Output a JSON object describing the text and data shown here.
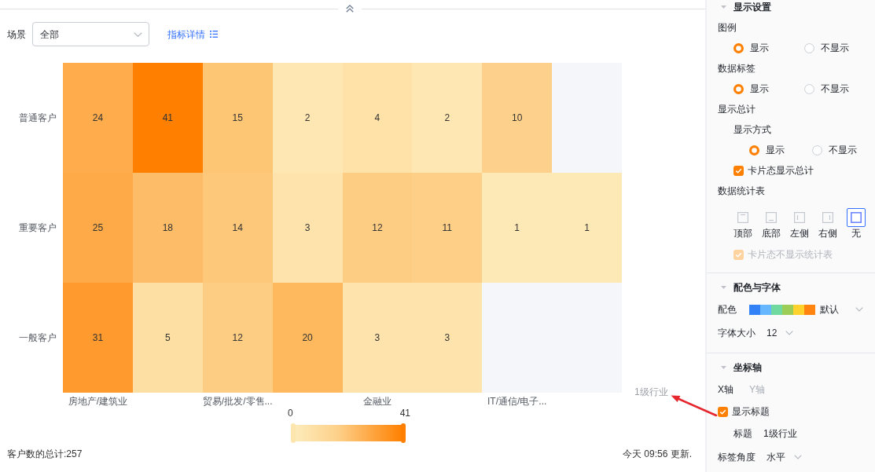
{
  "filter": {
    "label": "场景",
    "select": {
      "value": "全部"
    },
    "link": "指标详情"
  },
  "heatmap": {
    "rows": [
      {
        "label": "普通客户",
        "cells": [
          {
            "value": "24",
            "color": "#feac4c"
          },
          {
            "value": "41",
            "color": "#ff8000"
          },
          {
            "value": "15",
            "color": "#fdc675"
          },
          {
            "value": "2",
            "color": "#fee7b2"
          },
          {
            "value": "4",
            "color": "#fee2a7"
          },
          {
            "value": "2",
            "color": "#fee7b2"
          },
          {
            "value": "10",
            "color": "#fdd18b"
          },
          {
            "color": "#f5f6fa"
          }
        ]
      },
      {
        "label": "重要客户",
        "cells": [
          {
            "value": "25",
            "color": "#feaa48"
          },
          {
            "value": "18",
            "color": "#fdbd68"
          },
          {
            "value": "14",
            "color": "#fdc87a"
          },
          {
            "value": "3",
            "color": "#fee4ac"
          },
          {
            "value": "12",
            "color": "#fdcd83"
          },
          {
            "value": "11",
            "color": "#fdcf87"
          },
          {
            "value": "1",
            "color": "#fde9b6"
          },
          {
            "value": "1",
            "color": "#fde9b6"
          }
        ]
      },
      {
        "label": "一般客户",
        "cells": [
          {
            "value": "31",
            "color": "#fe9a2e"
          },
          {
            "value": "5",
            "color": "#fddfa3"
          },
          {
            "value": "12",
            "color": "#fdcd83"
          },
          {
            "value": "20",
            "color": "#feb85e"
          },
          {
            "value": "3",
            "color": "#fee4ac"
          },
          {
            "value": "3",
            "color": "#fee4ac"
          },
          {
            "color": "#f5f6fa"
          },
          {
            "color": "#f5f6fa"
          }
        ]
      }
    ],
    "x_labels": [
      "房地产/建筑业",
      "贸易/批发/零售...",
      "金融业",
      "IT/通信/电子..."
    ],
    "axis_title": "1级行业"
  },
  "color_scale": {
    "min_label": "0",
    "max_label": "41"
  },
  "footer": {
    "total": "客户数的总计:257",
    "updated": "今天 09:56 更新."
  },
  "settings": {
    "sections": [
      {
        "title": "显示设置",
        "expanded": true,
        "fields": [
          {
            "kind": "radio",
            "label": "图例",
            "options": [
              {
                "label": "显示",
                "selected": true
              },
              {
                "label": "不显示",
                "selected": false
              }
            ]
          },
          {
            "kind": "radio",
            "label": "数据标签",
            "options": [
              {
                "label": "显示",
                "selected": true
              },
              {
                "label": "不显示",
                "selected": false
              }
            ]
          },
          {
            "kind": "group",
            "label": "显示总计",
            "children": [
              {
                "kind": "radio",
                "label": "显示方式",
                "options": [
                  {
                    "label": "显示",
                    "selected": true
                  },
                  {
                    "label": "不显示",
                    "selected": false
                  }
                ]
              },
              {
                "kind": "checkbox",
                "label": "卡片态显示总计",
                "checked": true,
                "disabled": false
              }
            ]
          },
          {
            "kind": "group",
            "label": "数据统计表",
            "children": [
              {
                "kind": "positions",
                "options": [
                  {
                    "kind": "top",
                    "label": "顶部",
                    "selected": false
                  },
                  {
                    "kind": "bottom",
                    "label": "底部",
                    "selected": false
                  },
                  {
                    "kind": "left",
                    "label": "左侧",
                    "selected": false
                  },
                  {
                    "kind": "right",
                    "label": "右侧",
                    "selected": false
                  },
                  {
                    "kind": "none",
                    "label": "无",
                    "selected": true
                  }
                ]
              },
              {
                "kind": "checkbox",
                "label": "卡片态不显示统计表",
                "checked": true,
                "disabled": true
              }
            ]
          }
        ]
      },
      {
        "title": "配色与字体",
        "expanded": true,
        "fields": [
          {
            "kind": "palette",
            "label": "配色",
            "swatches": [
              {
                "color": "#3381f7"
              },
              {
                "color": "#66b7fd"
              },
              {
                "color": "#6fd9a0"
              },
              {
                "color": "#9ccd56"
              },
              {
                "color": "#ffd22e"
              },
              {
                "color": "#ff8410"
              }
            ],
            "value": "默认"
          },
          {
            "kind": "select",
            "label": "字体大小",
            "value": "12"
          }
        ]
      },
      {
        "title": "坐标轴",
        "expanded": true,
        "fields": [
          {
            "kind": "tabs",
            "tabs": [
              {
                "label": "X轴",
                "selected": true
              },
              {
                "label": "Y轴",
                "selected": false
              }
            ]
          },
          {
            "kind": "checkbox",
            "label": "显示标题",
            "checked": true,
            "disabled": false,
            "children": [
              {
                "kind": "text",
                "label": "标题",
                "value": "1级行业"
              }
            ]
          },
          {
            "kind": "select",
            "label": "标签角度",
            "value": "水平"
          }
        ]
      }
    ]
  }
}
